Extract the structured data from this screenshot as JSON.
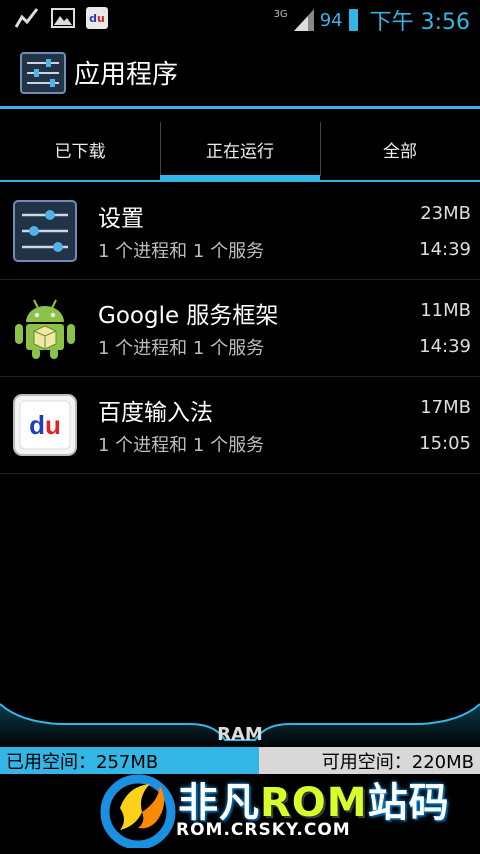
{
  "status_bar": {
    "icons": [
      "activity-icon",
      "image-icon",
      "baidu-input-icon"
    ],
    "du_label_d": "d",
    "du_label_u": "u",
    "network": "3G",
    "battery": "94",
    "time": "下午 3:56"
  },
  "action_bar": {
    "title": "应用程序",
    "icon": "settings-sliders-icon"
  },
  "tabs": [
    {
      "label": "已下载",
      "active": false
    },
    {
      "label": "正在运行",
      "active": true
    },
    {
      "label": "全部",
      "active": false
    }
  ],
  "apps": [
    {
      "name": "设置",
      "desc": "1 个进程和 1 个服务",
      "size": "23MB",
      "time": "14:39",
      "icon": "settings-sliders-icon"
    },
    {
      "name": "Google 服务框架",
      "desc": "1 个进程和 1 个服务",
      "size": "11MB",
      "time": "14:39",
      "icon": "android-robot-icon"
    },
    {
      "name": "百度输入法",
      "desc": "1 个进程和 1 个服务",
      "size": "17MB",
      "time": "15:05",
      "icon": "baidu-input-icon"
    }
  ],
  "ram": {
    "label": "RAM",
    "used": "已用空间：257MB",
    "free": "可用空间：220MB",
    "used_fraction": 0.539
  },
  "watermark": {
    "brand": "非凡",
    "rom": "ROM",
    "suffix": "站码",
    "url": "ROM.CRSKY.COM"
  },
  "colors": {
    "accent": "#33b5e5",
    "background": "#000000",
    "ram_free": "#d8d8d8"
  }
}
